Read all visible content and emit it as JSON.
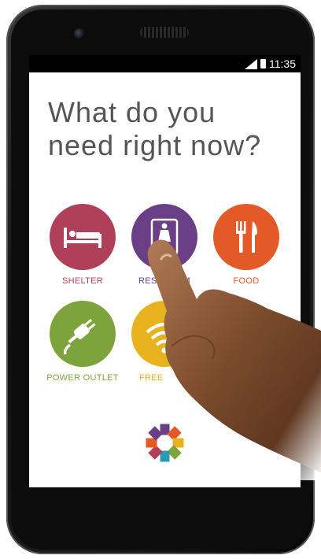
{
  "status_bar": {
    "time": "11:35"
  },
  "screen": {
    "title_line1": "What do you",
    "title_line2": "need right now?",
    "options": [
      {
        "label": "SHELTER",
        "color": "#b0405a",
        "icon": "bed-icon"
      },
      {
        "label": "RESTROOM",
        "color": "#6b3f86",
        "icon": "restroom-icon"
      },
      {
        "label": "FOOD",
        "color": "#e35a28",
        "icon": "utensils-icon"
      },
      {
        "label": "POWER OUTLET",
        "color": "#7da33c",
        "icon": "plug-icon"
      },
      {
        "label": "FREE",
        "color": "#e8b21e",
        "icon": "wifi-icon"
      }
    ],
    "logo": "flower-logo"
  }
}
